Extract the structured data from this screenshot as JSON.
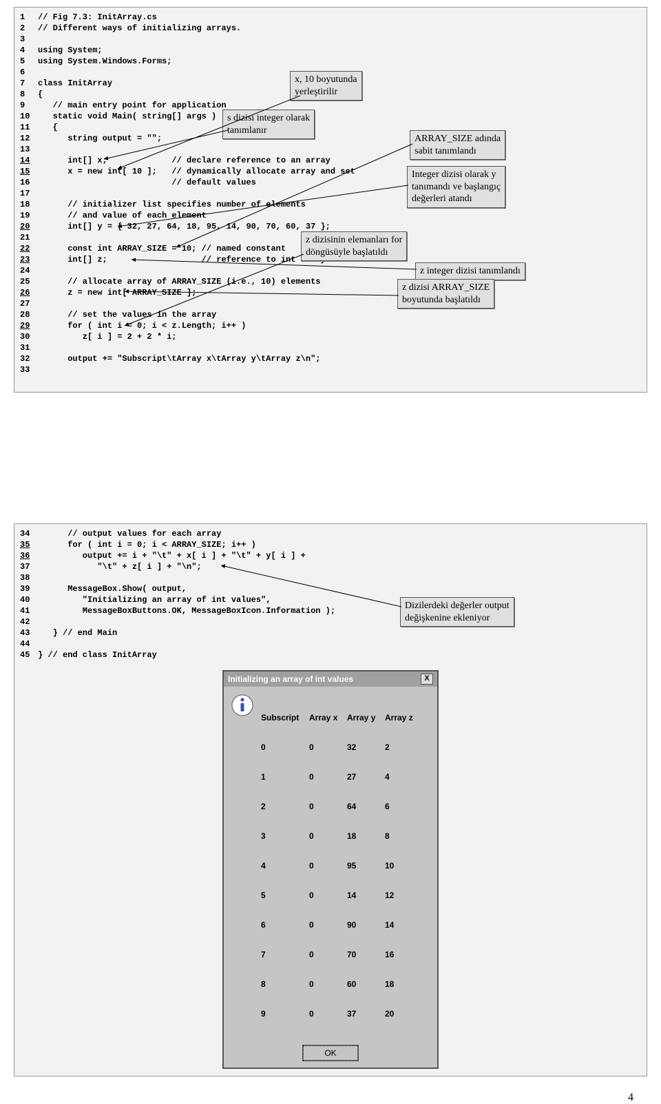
{
  "slide1": {
    "code": {
      "1": "// Fig 7.3: InitArray.cs",
      "2": "// Different ways of initializing arrays.",
      "3": "",
      "4": "using System;",
      "5": "using System.Windows.Forms;",
      "6": "",
      "7": "class InitArray",
      "8": "{",
      "9": "   // main entry point for application",
      "10": "   static void Main( string[] args )",
      "11": "   {",
      "12": "      string output = \"\";",
      "13": "",
      "14": "      int[] x;             // declare reference to an array",
      "15": "      x = new int[ 10 ];   // dynamically allocate array and set",
      "16": "                           // default values",
      "17": "",
      "18": "      // initializer list specifies number of elements",
      "19": "      // and value of each element",
      "20": "      int[] y = { 32, 27, 64, 18, 95, 14, 90, 70, 60, 37 };",
      "21": "",
      "22": "      const int ARRAY_SIZE = 10; // named constant",
      "23": "      int[] z;                   // reference to int array",
      "24": "",
      "25": "      // allocate array of ARRAY_SIZE (i.e., 10) elements",
      "26": "      z = new int[ ARRAY_SIZE ];",
      "27": "",
      "28": "      // set the values in the array",
      "29": "      for ( int i = 0; i < z.Length; i++ )",
      "30": "         z[ i ] = 2 + 2 * i;",
      "31": "",
      "32": "      output += \"Subscript\\tArray x\\tArray y\\tArray z\\n\";",
      "33": ""
    },
    "callouts": {
      "c1": "x, 10 boyutunda\nyerleştirilir",
      "c2": "s dizisi integer olarak\ntanımlanır",
      "c3": "ARRAY_SIZE adında\nsabit tanımlandı",
      "c4": "Integer dizisi olarak y\ntanımandı ve başlangıç\ndeğerleri atandı",
      "c5": "z dizisinin elemanları  for\ndöngüsüyle başlatıldı",
      "c6": "z integer dizisi tanımlandı",
      "c7": "z dizisi ARRAY_SIZE\nboyutunda başlatıldı"
    }
  },
  "slide2": {
    "code": {
      "34": "      // output values for each array",
      "35": "      for ( int i = 0; i < ARRAY_SIZE; i++ )",
      "36": "         output += i + \"\\t\" + x[ i ] + \"\\t\" + y[ i ] +",
      "37": "            \"\\t\" + z[ i ] + \"\\n\";",
      "38": "",
      "39": "      MessageBox.Show( output,",
      "40": "         \"Initializing an array of int values\",",
      "41": "         MessageBoxButtons.OK, MessageBoxIcon.Information );",
      "42": "",
      "43": "   } // end Main",
      "44": "",
      "45": "} // end class InitArray"
    },
    "callouts": {
      "c1": "Dizilerdeki değerler output\ndeğişkenine ekleniyor"
    },
    "dialog": {
      "title": "Initializing an array of int values",
      "close": "X",
      "headers": [
        "Subscript",
        "Array x",
        "Array y",
        "Array z"
      ],
      "rows": [
        [
          "0",
          "0",
          "32",
          "2"
        ],
        [
          "1",
          "0",
          "27",
          "4"
        ],
        [
          "2",
          "0",
          "64",
          "6"
        ],
        [
          "3",
          "0",
          "18",
          "8"
        ],
        [
          "4",
          "0",
          "95",
          "10"
        ],
        [
          "5",
          "0",
          "14",
          "12"
        ],
        [
          "6",
          "0",
          "90",
          "14"
        ],
        [
          "7",
          "0",
          "70",
          "16"
        ],
        [
          "8",
          "0",
          "60",
          "18"
        ],
        [
          "9",
          "0",
          "37",
          "20"
        ]
      ],
      "ok": "OK"
    }
  },
  "chart_data": {
    "type": "table",
    "title": "Initializing an array of int values",
    "headers": [
      "Subscript",
      "Array x",
      "Array y",
      "Array z"
    ],
    "rows": [
      [
        0,
        0,
        32,
        2
      ],
      [
        1,
        0,
        27,
        4
      ],
      [
        2,
        0,
        64,
        6
      ],
      [
        3,
        0,
        18,
        8
      ],
      [
        4,
        0,
        95,
        10
      ],
      [
        5,
        0,
        14,
        12
      ],
      [
        6,
        0,
        90,
        14
      ],
      [
        7,
        0,
        70,
        16
      ],
      [
        8,
        0,
        60,
        18
      ],
      [
        9,
        0,
        37,
        20
      ]
    ]
  },
  "page_number": "4"
}
